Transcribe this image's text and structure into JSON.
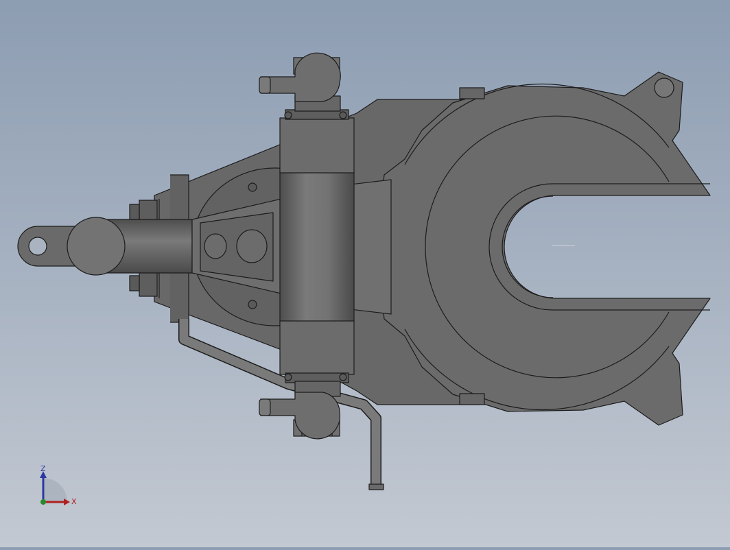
{
  "viewport": {
    "model_name": "hydraulic-gripper-assembly",
    "background_top": "#8d9db2",
    "background_bottom": "#c3c9d2",
    "part_fill": "#6a6a6a",
    "part_fill_dark": "#555555",
    "part_fill_light": "#7e7e7e",
    "edge_color": "#1c1c1c"
  },
  "triad": {
    "z_label": "Z",
    "x_label": "X",
    "z_color": "#2a3a9e",
    "x_color": "#b02020",
    "y_color": "#2a8a2a"
  }
}
